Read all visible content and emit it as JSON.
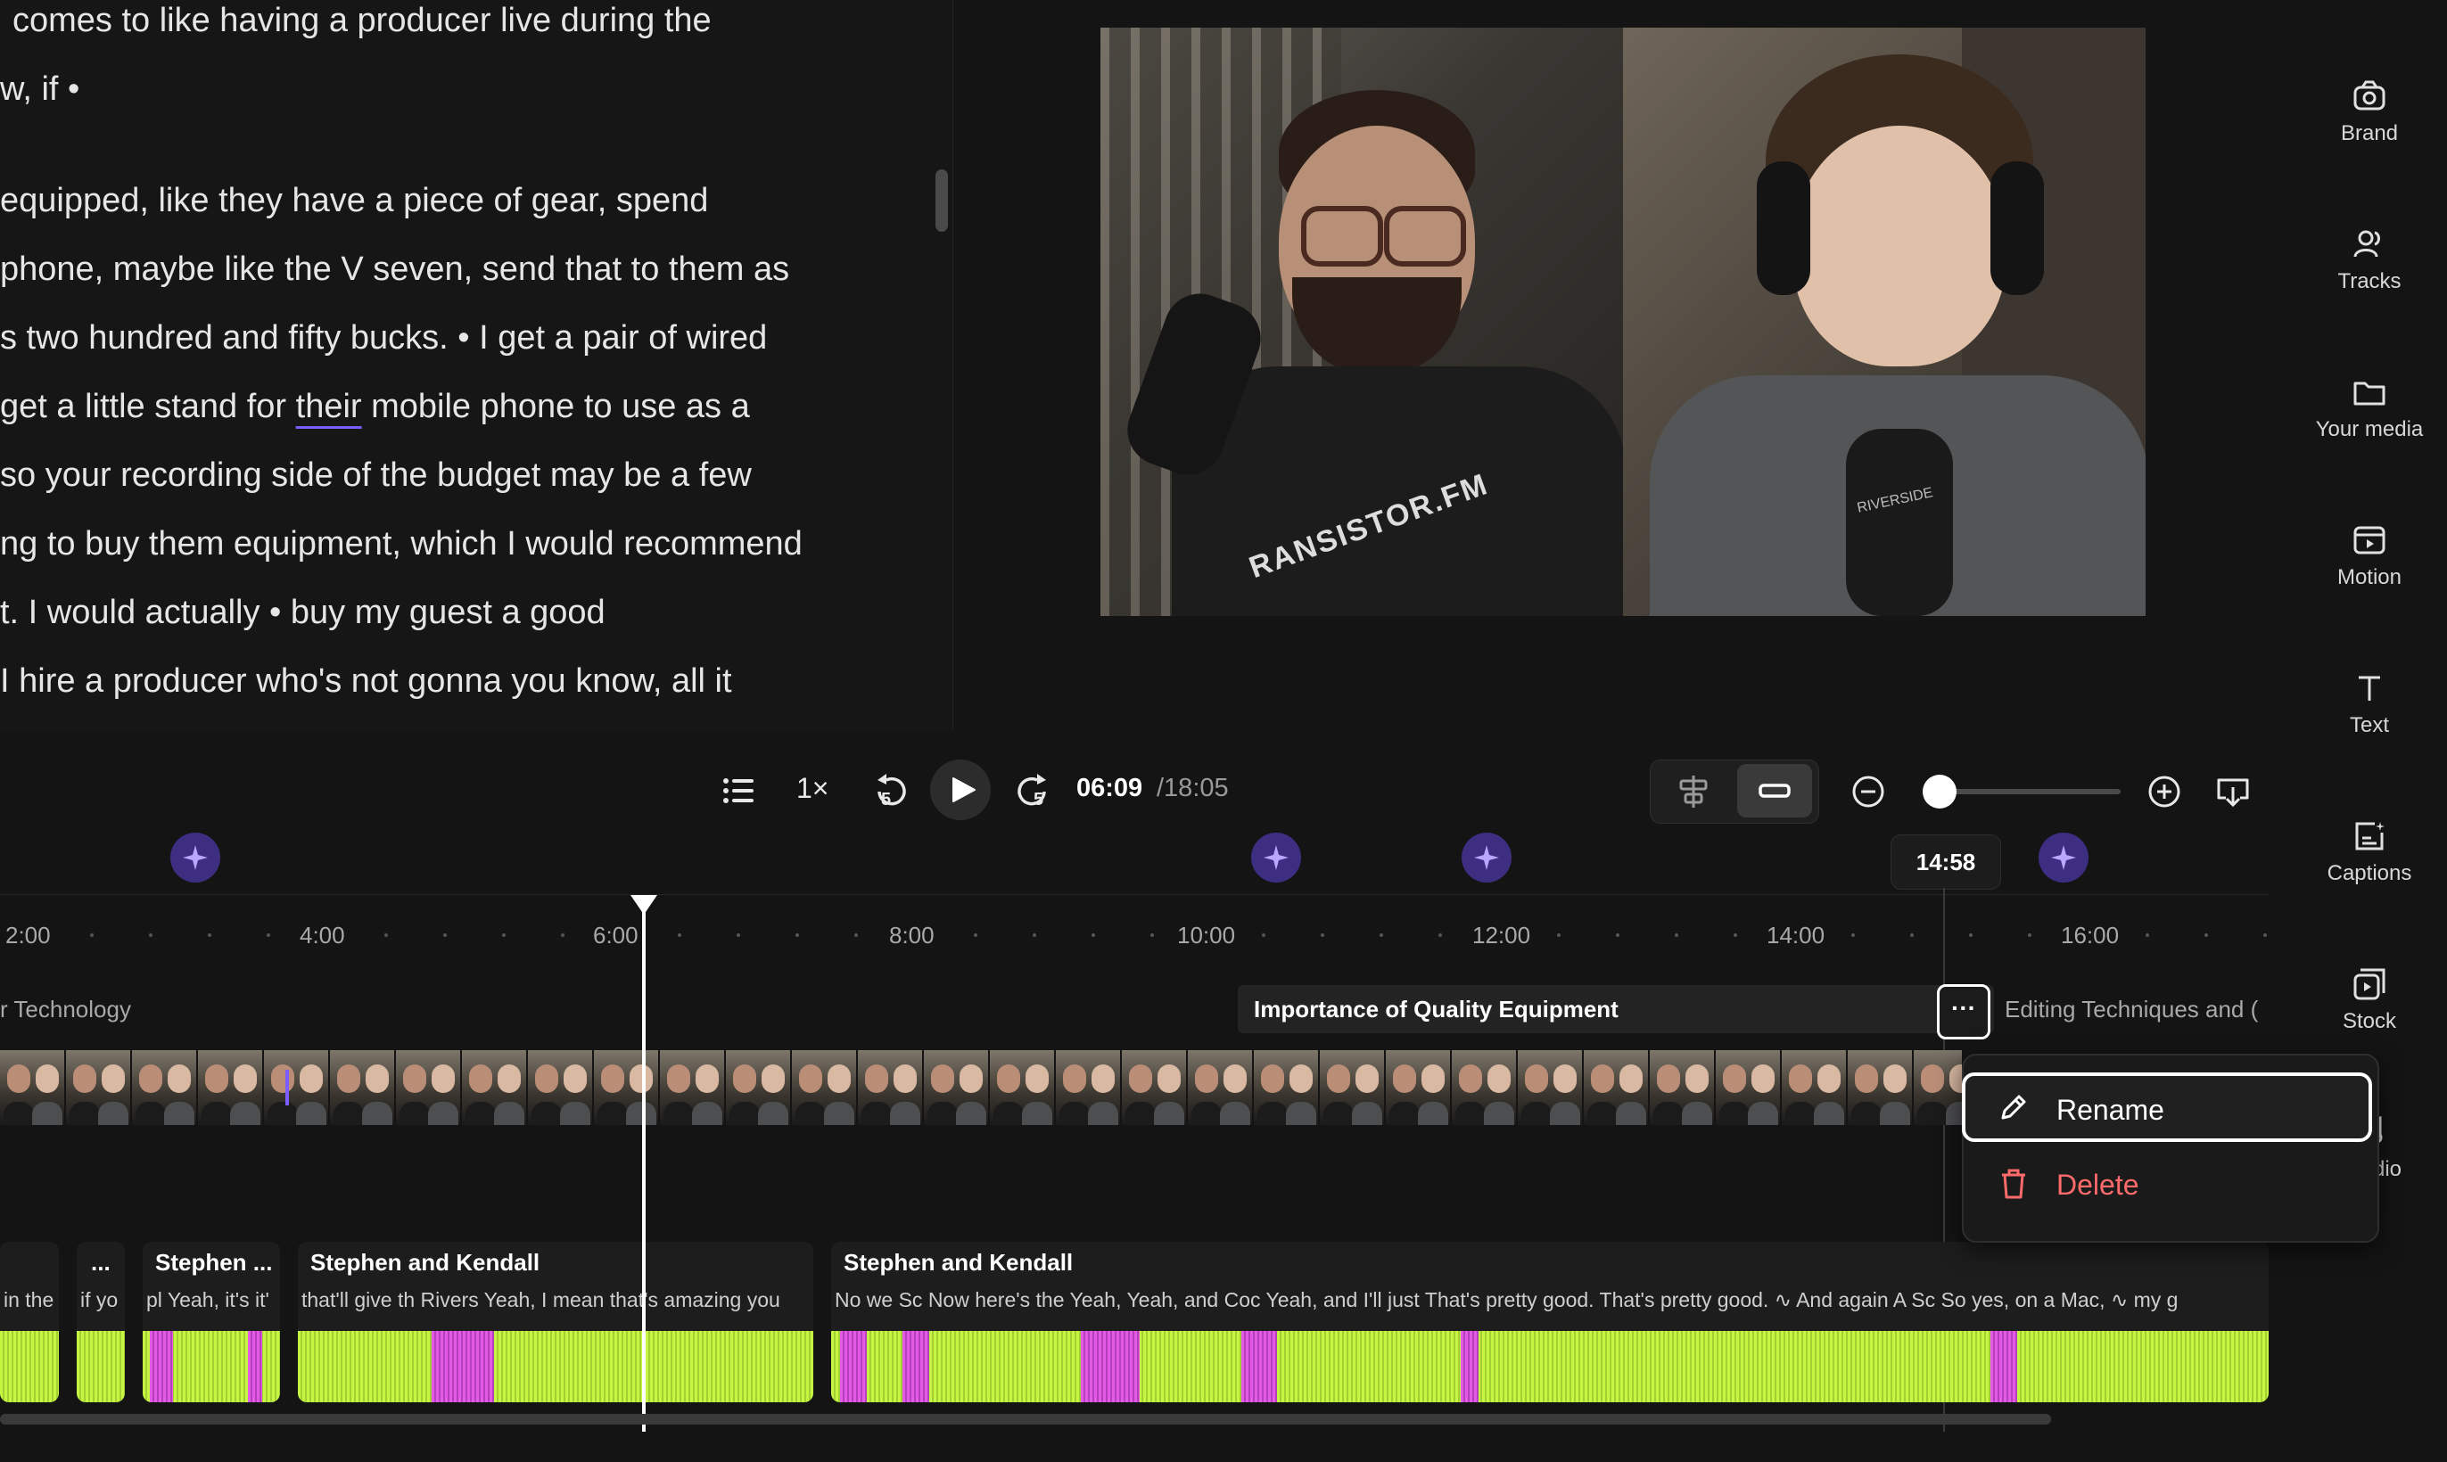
{
  "transcript": {
    "lines": [
      "comes to like having a producer live during the",
      "w, if •",
      "equipped, like they have a piece of gear, spend",
      "phone, maybe like the V seven, send that to them as",
      "s two hundred and fifty bucks. • I get a pair of wired",
      "get a little stand for ",
      "their",
      " mobile phone to use as a",
      "so your recording side of the budget may be a few",
      "ng to buy them equipment, which I would recommend",
      "t. I would actually • buy my guest a good",
      "I hire a producer who's not gonna you know, all it"
    ]
  },
  "video": {
    "shirt_text": "RANSISTOR.FM",
    "mic_text": "RIVERSIDE"
  },
  "rail": {
    "items": [
      {
        "label": "Brand",
        "icon": "brand-icon"
      },
      {
        "label": "Tracks",
        "icon": "tracks-icon"
      },
      {
        "label": "Your media",
        "icon": "folder-icon"
      },
      {
        "label": "Motion",
        "icon": "motion-icon"
      },
      {
        "label": "Text",
        "icon": "text-icon"
      },
      {
        "label": "Captions",
        "icon": "captions-icon"
      },
      {
        "label": "Stock",
        "icon": "stock-icon"
      },
      {
        "label": "dio",
        "icon": "audio-icon"
      }
    ]
  },
  "playback": {
    "speed": "1×",
    "skip_back": "5",
    "skip_forward": "5",
    "current_time": "06:09",
    "total_time": "/18:05",
    "zoom_level": 0.05
  },
  "timeline": {
    "hover_time": "14:58",
    "ticks": [
      "2:00",
      "4:00",
      "6:00",
      "8:00",
      "10:00",
      "12:00",
      "14:00",
      "16:00"
    ],
    "chapters": {
      "prev": "r Technology",
      "active": "Importance of Quality Equipment",
      "next": "Editing Techniques and ("
    },
    "more_button": "···",
    "clips": [
      {
        "title": "",
        "words": "in the"
      },
      {
        "title": "...",
        "words": "if yo"
      },
      {
        "title": "Stephen ...",
        "words": "pl Yeah, it's it'"
      },
      {
        "title": "Stephen and Kendall",
        "words": "that'll give th Rivers Yeah, I mean that's amazing you"
      },
      {
        "title": "Stephen and Kendall",
        "words": "No we Sc Now here's the Yeah, Yeah, and Coc Yeah, and I'll just  That's pretty good. That's pretty good. ∿ And again A Sc So yes, on a Mac, ∿ my g"
      }
    ]
  },
  "context_menu": {
    "rename": "Rename",
    "delete": "Delete"
  },
  "colors": {
    "accent": "#7a5cff",
    "waveform": "#c6f542",
    "waveform_alt": "#e35ae6",
    "danger": "#ff6b6b"
  }
}
